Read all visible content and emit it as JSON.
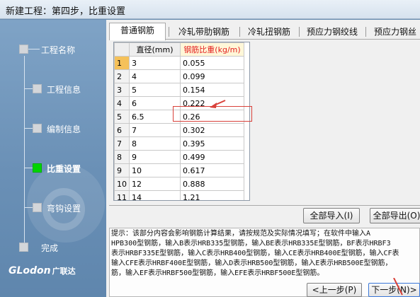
{
  "window": {
    "title": "新建工程：第四步，比重设置"
  },
  "steps": [
    {
      "label": "工程名称",
      "active": false
    },
    {
      "label": "工程信息",
      "active": false
    },
    {
      "label": "编制信息",
      "active": false
    },
    {
      "label": "比重设置",
      "active": true
    },
    {
      "label": "弯钩设置",
      "active": false
    },
    {
      "label": "完成",
      "active": false
    }
  ],
  "logo": {
    "text": "GLodon",
    "cn": "广联达"
  },
  "tabs": [
    "普通钢筋",
    "冷轧带肋钢筋",
    "冷轧扭钢筋",
    "预应力钢绞线",
    "预应力钢丝"
  ],
  "table": {
    "headers": [
      "",
      "直径(mm)",
      "钢筋比重(kg/m)"
    ],
    "rows": [
      [
        "1",
        "3",
        "0.055"
      ],
      [
        "2",
        "4",
        "0.099"
      ],
      [
        "3",
        "5",
        "0.154"
      ],
      [
        "4",
        "6",
        "0.222"
      ],
      [
        "5",
        "6.5",
        "0.26"
      ],
      [
        "6",
        "7",
        "0.302"
      ],
      [
        "7",
        "8",
        "0.395"
      ],
      [
        "8",
        "9",
        "0.499"
      ],
      [
        "9",
        "10",
        "0.617"
      ],
      [
        "10",
        "12",
        "0.888"
      ],
      [
        "11",
        "14",
        "1.21"
      ]
    ]
  },
  "buttons": {
    "import_all": "全部导入(I)",
    "export_all": "全部导出(O)",
    "prev": "<上一步(P)",
    "next": "下一步(N)>"
  },
  "hint": [
    "提示：该部分内容会影响钢筋计算结果，请按规范及实际情况填写；在软件中输入A",
    "HPB300型钢筋，输入B表示HRB335型钢筋，输入BE表示HRB335E型钢筋，BF表示HRBF3",
    "表示HRBF335E型钢筋，输入C表示HRB400型钢筋，输入CE表示HRB400E型钢筋，输入CF表",
    "输入CFE表示HRBF400E型钢筋，输入D表示HRB500型钢筋，输入E表示HRB500E型钢筋，",
    "筋，输入EF表示HRBF500型钢筋，输入EFE表示HRBF500E型钢筋。"
  ],
  "colors": {
    "active_step": "#00d400",
    "header_red": "#e31e1e",
    "annotation": "#d9413a"
  }
}
